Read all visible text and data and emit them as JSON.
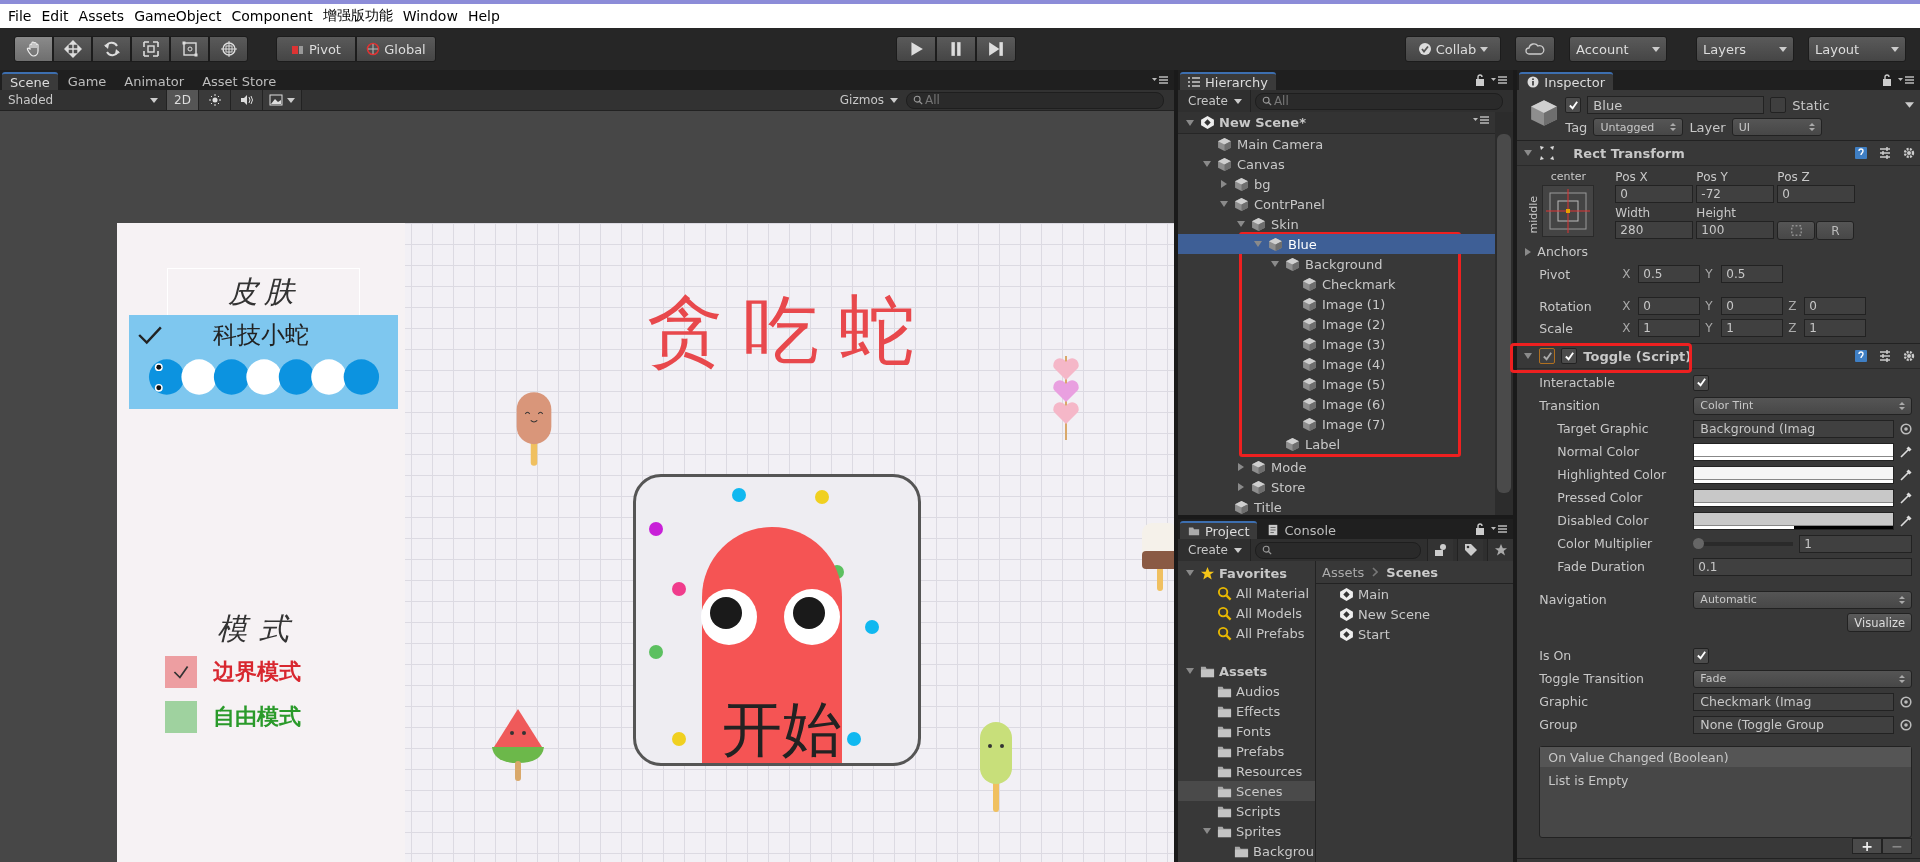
{
  "menu": [
    "File",
    "Edit",
    "Assets",
    "GameObject",
    "Component",
    "增强版功能",
    "Window",
    "Help"
  ],
  "tools": [
    {
      "kind": "hand",
      "selected": true
    },
    {
      "kind": "move",
      "selected": false
    },
    {
      "kind": "rotate",
      "selected": false
    },
    {
      "kind": "scale",
      "selected": false
    },
    {
      "kind": "rect",
      "selected": false
    },
    {
      "kind": "transform",
      "selected": false
    }
  ],
  "pivot": "Pivot",
  "global": "Global",
  "collab": "Collab",
  "account": "Account",
  "layers": "Layers",
  "layout": "Layout",
  "scene_panel": {
    "tabs": [
      {
        "label": "Scene",
        "selected": true
      },
      {
        "label": "Game",
        "selected": false
      },
      {
        "label": "Animator",
        "selected": false
      },
      {
        "label": "Asset Store",
        "selected": false
      }
    ],
    "shading": "Shaded",
    "mode_2d": {
      "label": "2D",
      "on": true
    },
    "gizmos": "Gizmos",
    "search_placeholder": "All"
  },
  "game": {
    "skin_title": "皮肤",
    "skin_toggle": {
      "label": "科技小蛇",
      "checked": true
    },
    "title": "贪吃蛇",
    "start_button": "开始",
    "mode_title": "模式",
    "modes": [
      {
        "label": "边界模式",
        "checked": true,
        "color": "#d8272f"
      },
      {
        "label": "自由模式",
        "checked": false,
        "color": "#2a9a2a"
      }
    ]
  },
  "hierarchy": {
    "tab": "Hierarchy",
    "create": "Create",
    "search_placeholder": "All",
    "scene": "New Scene*",
    "tree": [
      {
        "name": "Main Camera",
        "selected": false
      },
      {
        "name": "Canvas",
        "expanded": true,
        "selected": false,
        "children": [
          {
            "name": "bg",
            "expanded": false,
            "selected": false
          },
          {
            "name": "ContrPanel",
            "expanded": true,
            "selected": false,
            "children": [
              {
                "name": "Skin",
                "expanded": true,
                "selected": false,
                "children": [
                  {
                    "name": "Blue",
                    "expanded": true,
                    "selected": true,
                    "annotated": true,
                    "children": [
                      {
                        "name": "Background",
                        "expanded": true,
                        "selected": false,
                        "children": [
                          {
                            "name": "Checkmark",
                            "selected": false
                          },
                          {
                            "name": "Image (1)",
                            "selected": false
                          },
                          {
                            "name": "Image (2)",
                            "selected": false
                          },
                          {
                            "name": "Image (3)",
                            "selected": false
                          },
                          {
                            "name": "Image (4)",
                            "selected": false
                          },
                          {
                            "name": "Image (5)",
                            "selected": false
                          },
                          {
                            "name": "Image (6)",
                            "selected": false
                          },
                          {
                            "name": "Image (7)",
                            "selected": false
                          }
                        ]
                      },
                      {
                        "name": "Label",
                        "selected": false
                      }
                    ]
                  }
                ]
              },
              {
                "name": "Mode",
                "expanded": false,
                "selected": false
              },
              {
                "name": "Store",
                "expanded": false,
                "selected": false
              }
            ]
          },
          {
            "name": "Title",
            "selected": false
          }
        ]
      }
    ]
  },
  "project": {
    "tabs": [
      {
        "label": "Project",
        "selected": true
      },
      {
        "label": "Console",
        "selected": false
      }
    ],
    "create": "Create",
    "tree": [
      {
        "name": "Favorites",
        "kind": "favorites",
        "expanded": true,
        "selected": false,
        "children": [
          {
            "name": "All Material",
            "kind": "search",
            "selected": false
          },
          {
            "name": "All Models",
            "kind": "search",
            "selected": false
          },
          {
            "name": "All Prefabs",
            "kind": "search",
            "selected": false
          }
        ]
      },
      {
        "name": "Assets",
        "kind": "folder",
        "expanded": true,
        "selected": false,
        "children": [
          {
            "name": "Audios",
            "kind": "folder",
            "selected": false
          },
          {
            "name": "Effects",
            "kind": "folder",
            "selected": false
          },
          {
            "name": "Fonts",
            "kind": "folder",
            "selected": false
          },
          {
            "name": "Prefabs",
            "kind": "folder",
            "selected": false
          },
          {
            "name": "Resources",
            "kind": "folder",
            "selected": false
          },
          {
            "name": "Scenes",
            "kind": "folder",
            "selected": true
          },
          {
            "name": "Scripts",
            "kind": "folder",
            "selected": false
          },
          {
            "name": "Sprites",
            "kind": "folder",
            "expanded": true,
            "selected": false,
            "children": [
              {
                "name": "Backgrou",
                "kind": "folder",
                "selected": false
              }
            ]
          }
        ]
      }
    ],
    "breadcrumb": [
      "Assets",
      "Scenes"
    ],
    "files": [
      "Main",
      "New Scene",
      "Start"
    ]
  },
  "inspector": {
    "tab": "Inspector",
    "active": true,
    "name": "Blue",
    "static": {
      "label": "Static",
      "checked": false
    },
    "tag_label": "Tag",
    "tag": "Untagged",
    "layer_label": "Layer",
    "layer": "UI",
    "rect_transform": {
      "title": "Rect Transform",
      "anchor_h": "center",
      "anchor_v": "middle",
      "fields": [
        {
          "label": "Pos X",
          "value": "0"
        },
        {
          "label": "Pos Y",
          "value": "-72"
        },
        {
          "label": "Pos Z",
          "value": "0"
        },
        {
          "label": "Width",
          "value": "280"
        },
        {
          "label": "Height",
          "value": "100"
        }
      ],
      "raw_button": "R",
      "anchors": "Anchors",
      "vectors": [
        {
          "label": "Pivot",
          "values": [
            {
              "axis": "X",
              "value": "0.5"
            },
            {
              "axis": "Y",
              "value": "0.5"
            }
          ]
        },
        {
          "label": "Rotation",
          "values": [
            {
              "axis": "X",
              "value": "0"
            },
            {
              "axis": "Y",
              "value": "0"
            },
            {
              "axis": "Z",
              "value": "0"
            }
          ]
        },
        {
          "label": "Scale",
          "values": [
            {
              "axis": "X",
              "value": "1"
            },
            {
              "axis": "Y",
              "value": "1"
            },
            {
              "axis": "Z",
              "value": "1"
            }
          ]
        }
      ]
    },
    "toggle": {
      "title": "Toggle (Script)",
      "enabled": true,
      "annotated": true,
      "sections": [
        [
          {
            "kind": "check",
            "label": "Interactable",
            "checked": true
          },
          {
            "kind": "select",
            "label": "Transition",
            "value": "Color Tint",
            "children": [
              {
                "kind": "object",
                "label": "Target Graphic",
                "value": "Background (Imag"
              },
              {
                "kind": "color",
                "label": "Normal Color",
                "color": "#ffffff",
                "level": 1
              },
              {
                "kind": "color",
                "label": "Highlighted Color",
                "color": "#f5f5f5",
                "level": 1
              },
              {
                "kind": "color",
                "label": "Pressed Color",
                "color": "#c8c8c8",
                "level": 1
              },
              {
                "kind": "color",
                "label": "Disabled Color",
                "color": "#c8c8c8",
                "level": 0.5
              },
              {
                "kind": "slider",
                "label": "Color Multiplier",
                "level": 0,
                "reading": "1"
              },
              {
                "kind": "number",
                "label": "Fade Duration",
                "value": "0.1"
              }
            ]
          }
        ],
        [
          {
            "kind": "select",
            "label": "Navigation",
            "value": "Automatic"
          },
          {
            "kind": "button",
            "label": "Visualize"
          }
        ],
        [
          {
            "kind": "check",
            "label": "Is On",
            "checked": true
          },
          {
            "kind": "select",
            "label": "Toggle Transition",
            "value": "Fade"
          },
          {
            "kind": "object",
            "label": "Graphic",
            "value": "Checkmark (Imag"
          },
          {
            "kind": "object",
            "label": "Group",
            "value": "None (Toggle Group"
          }
        ]
      ],
      "event": {
        "title": "On Value Changed (Boolean)",
        "empty_text": "List is Empty",
        "add": "+",
        "remove": "−"
      }
    }
  }
}
